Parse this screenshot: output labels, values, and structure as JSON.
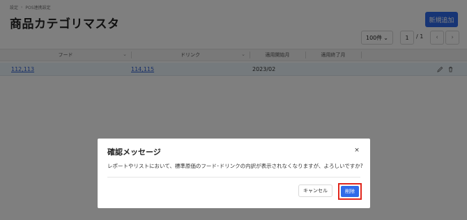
{
  "breadcrumb": [
    "設定",
    "POS連携設定"
  ],
  "breadcrumb_sep": "›",
  "page_title": "商品カテゴリマスタ",
  "add_button": "新規追加",
  "pagination": {
    "per_page": "100件",
    "current_page": "1",
    "total": "/ 1",
    "prev": "‹",
    "next": "›"
  },
  "table": {
    "columns": [
      "フード",
      "ドリンク",
      "適用開始月",
      "適用終了月"
    ],
    "rows": [
      {
        "food": "112,113",
        "drink": "114,115",
        "start": "2023/02",
        "end": ""
      }
    ]
  },
  "modal": {
    "title": "確認メッセージ",
    "close": "×",
    "message": "レポートやリストにおいて、標準原価のフード･ドリンクの内訳が表示されなくなりますが、よろしいですか?",
    "cancel": "キャンセル",
    "delete": "削除"
  },
  "colors": {
    "primary": "#2f6bea",
    "highlight": "#e0261c",
    "row_bg": "#eaf4fa"
  }
}
